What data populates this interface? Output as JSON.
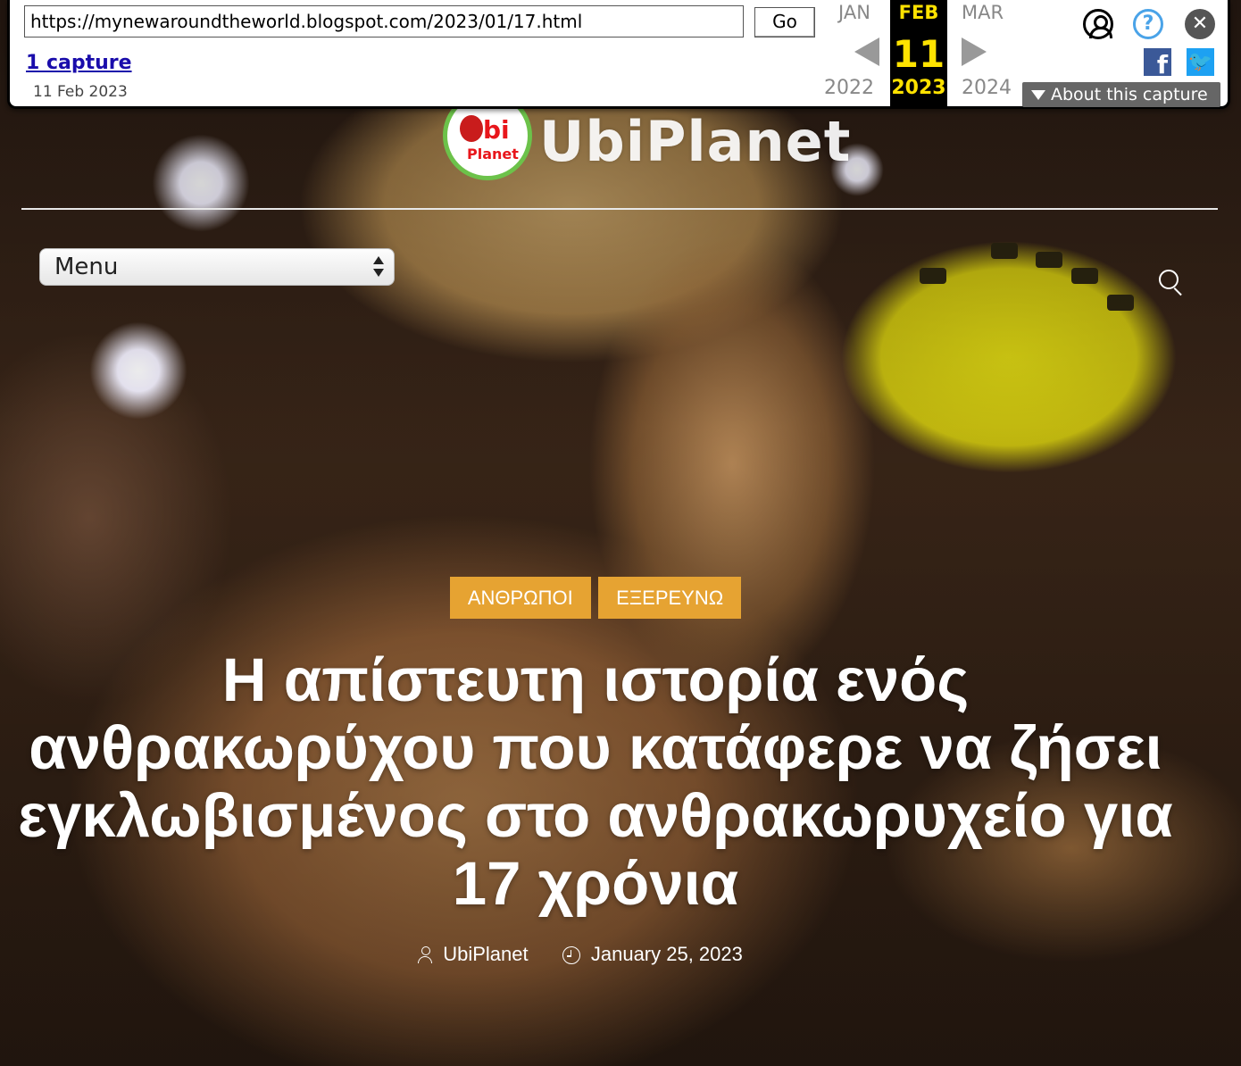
{
  "wayback": {
    "url": "https://mynewaroundtheworld.blogspot.com/2023/01/17.html",
    "go_label": "Go",
    "captures_link": "1 capture",
    "capture_date": "11 Feb 2023",
    "months": {
      "prev": "JAN",
      "current": "FEB",
      "next": "MAR"
    },
    "day": "11",
    "years": {
      "prev": "2022",
      "current": "2023",
      "next": "2024"
    },
    "about_label": "About this capture",
    "help_glyph": "?",
    "close_glyph": "✕",
    "facebook_glyph": "f",
    "twitter_glyph": "🐦"
  },
  "site": {
    "logo_text": "UbiPlanet",
    "logo_badge_top": "bi",
    "logo_badge_bottom": "Planet",
    "menu_label": "Menu"
  },
  "article": {
    "categories": [
      "ΑΝΘΡΩΠΟΙ",
      "ΕΞΕΡΕΥΝΩ"
    ],
    "title": "Η απίστευτη ιστορία ενός ανθρακωρύχου που κατάφερε να ζήσει εγκλωβισμένος στο ανθρακωρυχείο για 17 χρόνια",
    "author": "UbiPlanet",
    "date": "January 25, 2023"
  },
  "colors": {
    "category_badge": "#e6a332",
    "logo_ring": "#6cc24a",
    "logo_red": "#e8161b",
    "wayback_highlight": "#ffe200"
  },
  "icons": {
    "user": "user-circle-icon",
    "help": "help-icon",
    "close": "close-icon",
    "facebook": "facebook-icon",
    "twitter": "twitter-icon",
    "search": "search-icon",
    "author": "user-icon",
    "date": "clock-icon"
  }
}
